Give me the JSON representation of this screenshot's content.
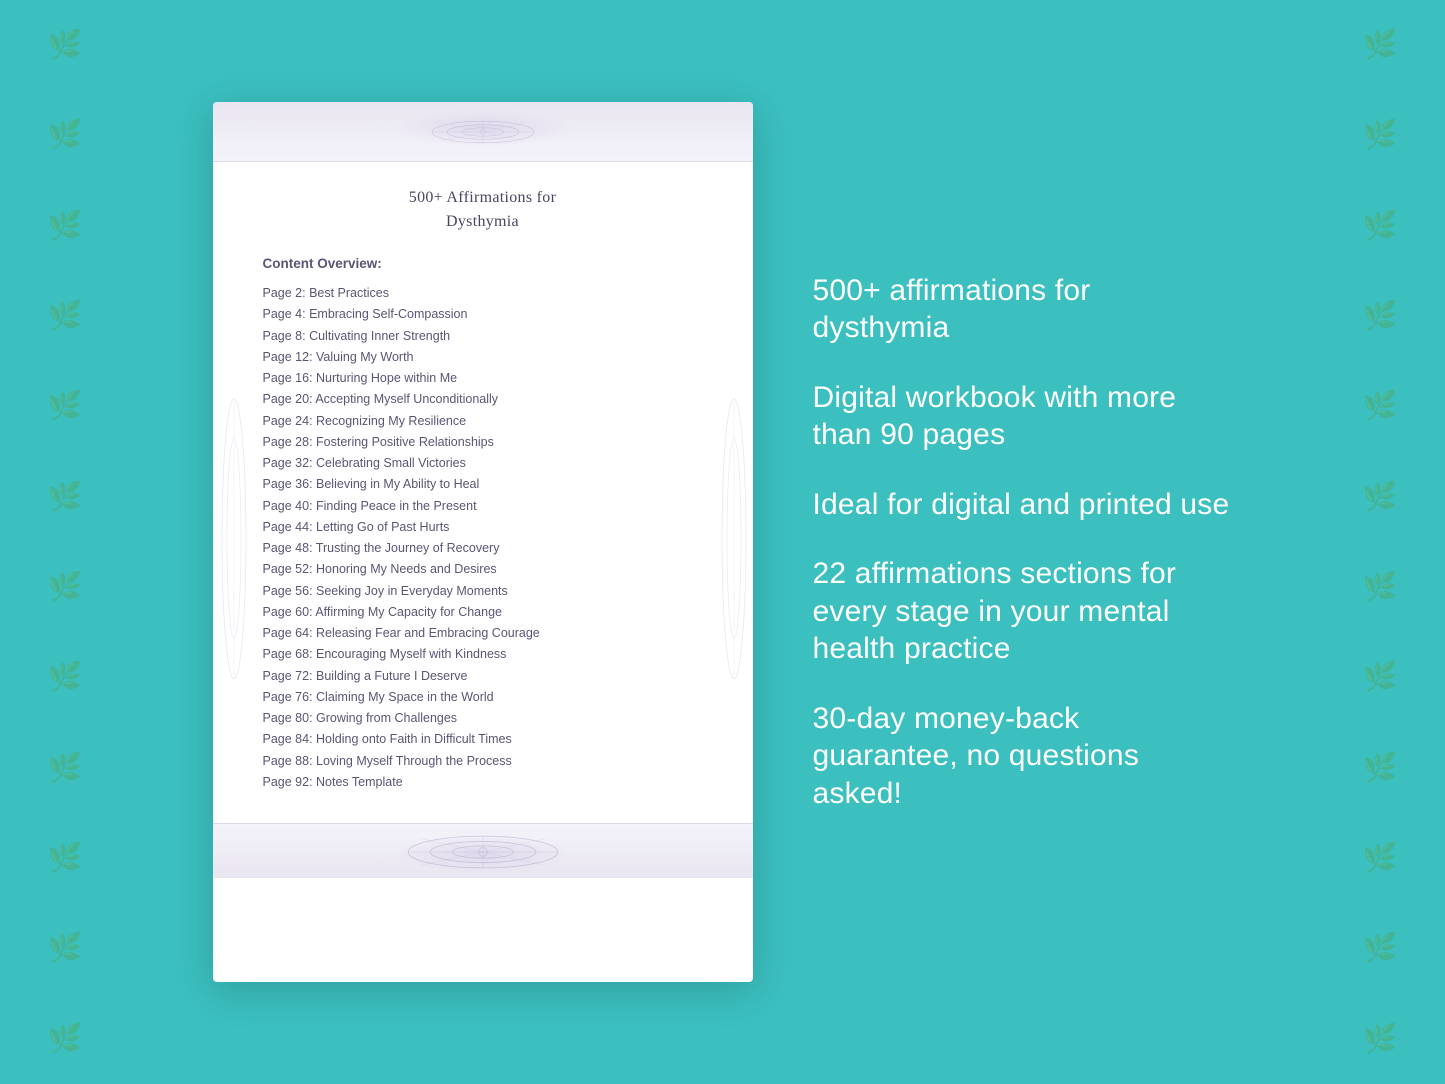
{
  "background": {
    "color": "#3bbfbf"
  },
  "document": {
    "title_line1": "500+ Affirmations for",
    "title_line2": "Dysthymia",
    "section_label": "Content Overview:",
    "toc": [
      {
        "page": "Page  2:",
        "title": "Best Practices"
      },
      {
        "page": "Page  4:",
        "title": "Embracing Self-Compassion"
      },
      {
        "page": "Page  8:",
        "title": "Cultivating Inner Strength"
      },
      {
        "page": "Page 12:",
        "title": "Valuing My Worth"
      },
      {
        "page": "Page 16:",
        "title": "Nurturing Hope within Me"
      },
      {
        "page": "Page 20:",
        "title": "Accepting Myself Unconditionally"
      },
      {
        "page": "Page 24:",
        "title": "Recognizing My Resilience"
      },
      {
        "page": "Page 28:",
        "title": "Fostering Positive Relationships"
      },
      {
        "page": "Page 32:",
        "title": "Celebrating Small Victories"
      },
      {
        "page": "Page 36:",
        "title": "Believing in My Ability to Heal"
      },
      {
        "page": "Page 40:",
        "title": "Finding Peace in the Present"
      },
      {
        "page": "Page 44:",
        "title": "Letting Go of Past Hurts"
      },
      {
        "page": "Page 48:",
        "title": "Trusting the Journey of Recovery"
      },
      {
        "page": "Page 52:",
        "title": "Honoring My Needs and Desires"
      },
      {
        "page": "Page 56:",
        "title": "Seeking Joy in Everyday Moments"
      },
      {
        "page": "Page 60:",
        "title": "Affirming My Capacity for Change"
      },
      {
        "page": "Page 64:",
        "title": "Releasing Fear and Embracing Courage"
      },
      {
        "page": "Page 68:",
        "title": "Encouraging Myself with Kindness"
      },
      {
        "page": "Page 72:",
        "title": "Building a Future I Deserve"
      },
      {
        "page": "Page 76:",
        "title": "Claiming My Space in the World"
      },
      {
        "page": "Page 80:",
        "title": "Growing from Challenges"
      },
      {
        "page": "Page 84:",
        "title": "Holding onto Faith in Difficult Times"
      },
      {
        "page": "Page 88:",
        "title": "Loving Myself Through the Process"
      },
      {
        "page": "Page 92:",
        "title": "Notes Template"
      }
    ]
  },
  "features": [
    "500+ affirmations for dysthymia",
    "Digital workbook with more than 90 pages",
    "Ideal for digital and printed use",
    "22 affirmations sections for every stage in your mental health practice",
    "30-day money-back guarantee, no questions asked!"
  ]
}
